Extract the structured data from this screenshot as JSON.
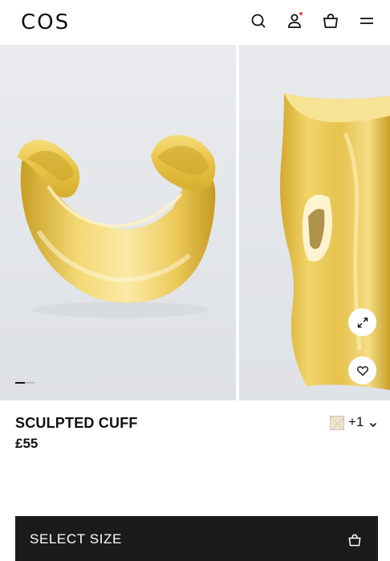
{
  "header": {
    "logo": "COS",
    "icons": [
      "search-icon",
      "account-icon",
      "bag-icon",
      "menu-icon"
    ],
    "notification_dot_color": "#e5533b"
  },
  "gallery": {
    "slides": [
      {
        "depicts": "gold-cuff-bracelet"
      },
      {
        "depicts": "gold-cuff-bracelet-closeup"
      }
    ],
    "active_slide": 1,
    "slide_count": 2
  },
  "product": {
    "title": "SCULPTED CUFF",
    "price": "£55",
    "more_colors": "+1"
  },
  "cta": {
    "label": "SELECT SIZE"
  },
  "colors": {
    "cta_background": "#1b1b1b",
    "gold": "#e7c44a"
  }
}
